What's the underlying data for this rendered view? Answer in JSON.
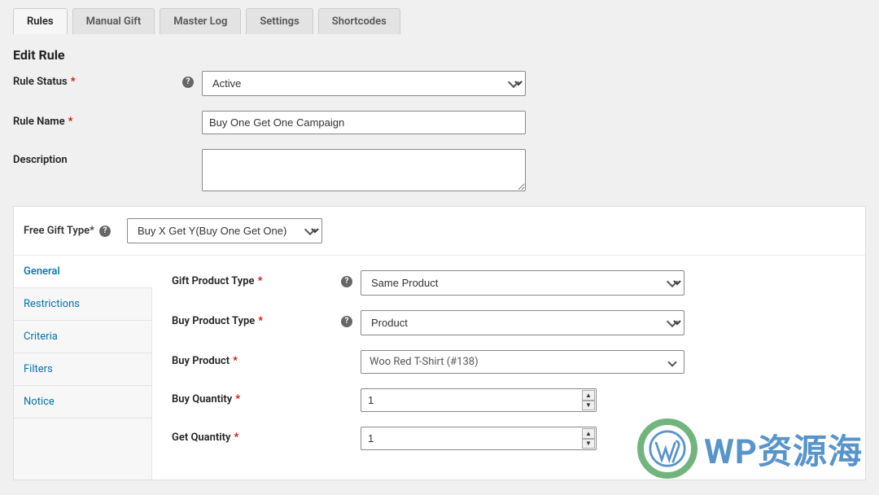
{
  "tabs": [
    {
      "label": "Rules",
      "active": true
    },
    {
      "label": "Manual Gift",
      "active": false
    },
    {
      "label": "Master Log",
      "active": false
    },
    {
      "label": "Settings",
      "active": false
    },
    {
      "label": "Shortcodes",
      "active": false
    }
  ],
  "page_title": "Edit Rule",
  "form": {
    "rule_status": {
      "label": "Rule Status",
      "required": true,
      "value": "Active"
    },
    "rule_name": {
      "label": "Rule Name",
      "required": true,
      "value": "Buy One Get One Campaign"
    },
    "description": {
      "label": "Description",
      "required": false,
      "value": ""
    }
  },
  "panel": {
    "free_gift_type": {
      "label": "Free Gift Type",
      "required": true,
      "value": "Buy X Get Y(Buy One Get One)"
    },
    "side_nav": [
      {
        "label": "General",
        "active": true
      },
      {
        "label": "Restrictions",
        "active": false
      },
      {
        "label": "Criteria",
        "active": false
      },
      {
        "label": "Filters",
        "active": false
      },
      {
        "label": "Notice",
        "active": false
      }
    ],
    "fields": {
      "gift_product_type": {
        "label": "Gift Product Type",
        "required": true,
        "value": "Same Product"
      },
      "buy_product_type": {
        "label": "Buy Product Type",
        "required": true,
        "value": "Product"
      },
      "buy_product": {
        "label": "Buy Product",
        "required": true,
        "value": "Woo Red T-Shirt (#138)"
      },
      "buy_quantity": {
        "label": "Buy Quantity",
        "required": true,
        "value": "1"
      },
      "get_quantity": {
        "label": "Get Quantity",
        "required": true,
        "value": "1"
      }
    }
  },
  "watermark": "WP资源海"
}
